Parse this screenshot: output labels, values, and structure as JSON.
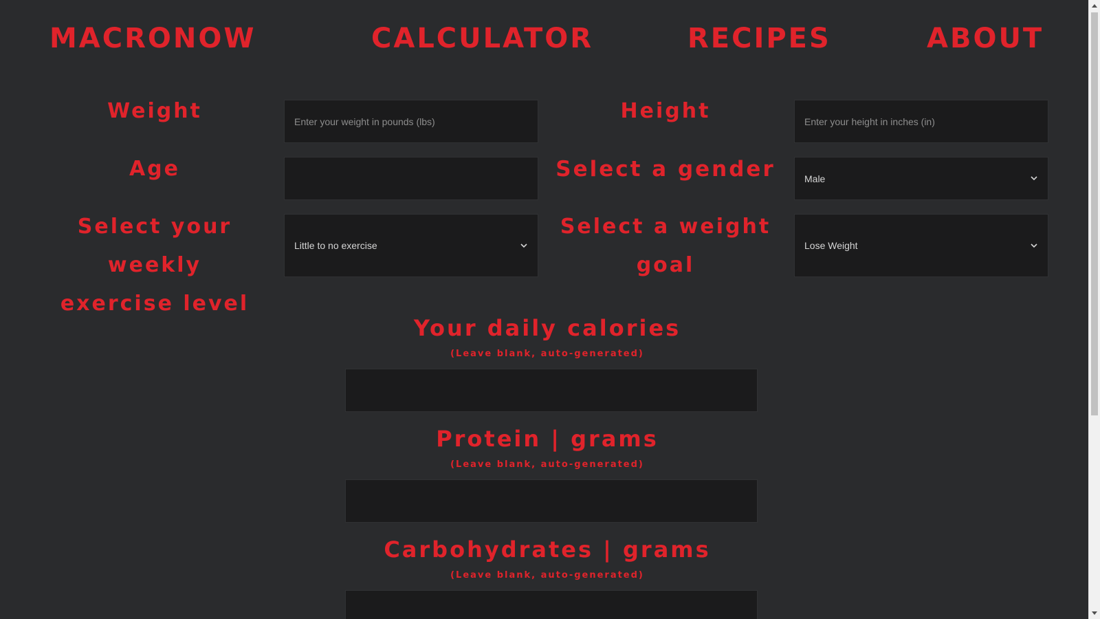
{
  "nav": {
    "brand": "MACRONOW",
    "calculator": "CALCULATOR",
    "recipes": "RECIPES",
    "about": "ABOUT"
  },
  "form": {
    "weight": {
      "label": "Weight",
      "placeholder": "Enter your weight in pounds (lbs)"
    },
    "height": {
      "label": "Height",
      "placeholder": "Enter your height in inches (in)"
    },
    "age": {
      "label": "Age",
      "value": ""
    },
    "gender": {
      "label": "Select a gender",
      "selected": "Male"
    },
    "exercise": {
      "label_line1": "Select your weekly",
      "label_line2": "exercise level",
      "selected": "Little to no exercise"
    },
    "goal": {
      "label_line1": "Select a weight",
      "label_line2": "goal",
      "selected": "Lose Weight"
    }
  },
  "results": {
    "calories": {
      "title": "Your daily calories",
      "note": "(Leave blank, auto-generated)"
    },
    "protein": {
      "title": "Protein | grams",
      "note": "(Leave blank, auto-generated)"
    },
    "carbs": {
      "title": "Carbohydrates | grams",
      "note": "(Leave blank, auto-generated)"
    }
  },
  "icons": {
    "chevron": "chevron-down-icon"
  },
  "colors": {
    "accent": "#e0232b",
    "background": "#2a2b2d",
    "field": "#1b1b1c"
  }
}
